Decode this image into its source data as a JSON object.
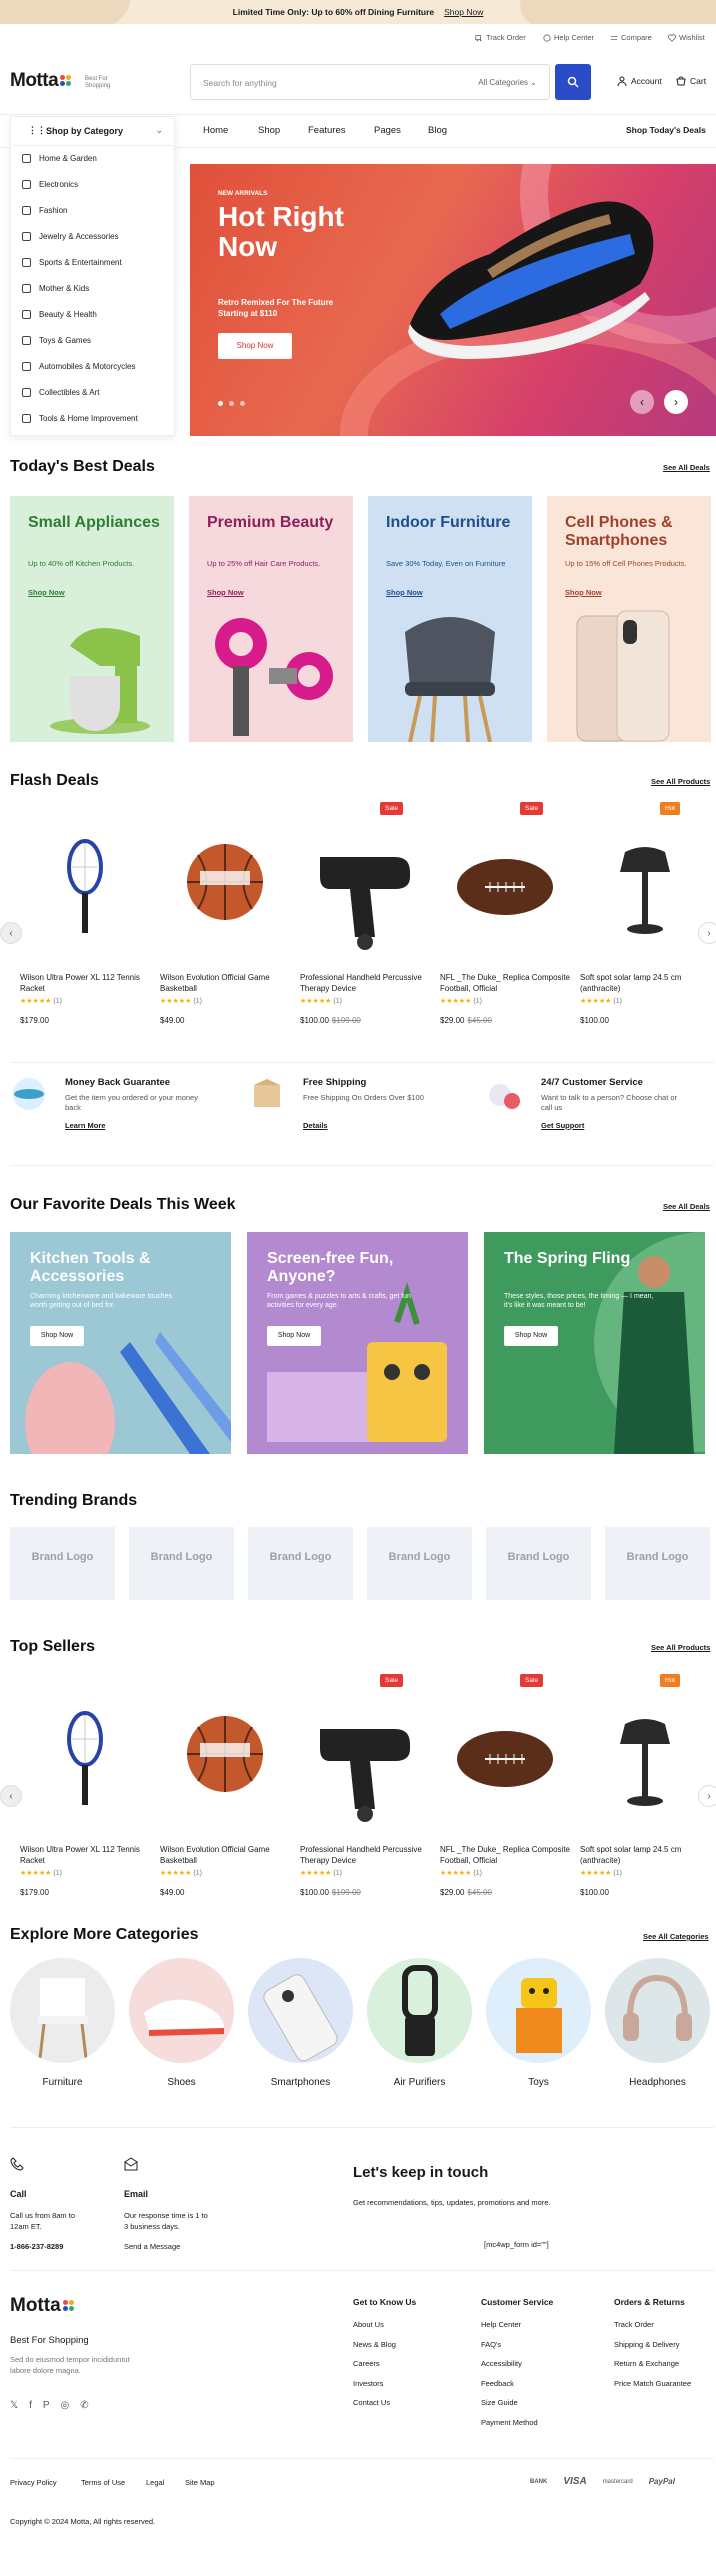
{
  "promo": {
    "text": "Limited Time Only: Up to 60% off Dining Furniture",
    "link": "Shop Now"
  },
  "toplinks": [
    "Track Order",
    "Help Center",
    "Compare",
    "Wishlist"
  ],
  "logo": {
    "name": "Motta",
    "sub1": "Best For",
    "sub2": "Shopping",
    "dot_colors": [
      "#e84c3d",
      "#f5a623",
      "#2a4cc9",
      "#27ae60"
    ]
  },
  "search": {
    "placeholder": "Search for anything",
    "category": "All Categories"
  },
  "header": {
    "account": "Account",
    "cart": "Cart"
  },
  "nav": {
    "category_button": "Shop by Category",
    "items": [
      "Home",
      "Shop",
      "Features",
      "Pages",
      "Blog"
    ],
    "right": "Shop Today's Deals"
  },
  "categories": [
    "Home & Garden",
    "Electronics",
    "Fashion",
    "Jewelry & Accessories",
    "Sports & Entertainment",
    "Mother & Kids",
    "Beauty & Health",
    "Toys & Games",
    "Automobiles & Motorcycles",
    "Collectibles & Art",
    "Tools & Home Improvement"
  ],
  "hero": {
    "tag": "NEW ARRIVALS",
    "title": "Hot Right Now",
    "subtitle": "Retro Remixed For The Future Starting at $110",
    "button": "Shop Now"
  },
  "best_deals": {
    "title": "Today's Best Deals",
    "link": "See All Deals",
    "cards": [
      {
        "title": "Small Appliances",
        "desc": "Up to 40% off Kitchen Products.",
        "link": "Shop Now",
        "bg": "#d8efd9",
        "color": "#2e7d32"
      },
      {
        "title": "Premium Beauty",
        "desc": "Up to 25% off Hair Care Products.",
        "link": "Shop Now",
        "bg": "#f6d9dd",
        "color": "#8e1f5b"
      },
      {
        "title": "Indoor Furniture",
        "desc": "Save 30% Today, Even on Furniture",
        "link": "Shop Now",
        "bg": "#cfe0f3",
        "color": "#1e4f8a"
      },
      {
        "title": "Cell Phones & Smartphones",
        "desc": "Up to 15% off Cell Phones Products.",
        "link": "Shop Now",
        "bg": "#f9e6d8",
        "color": "#a0412d"
      }
    ]
  },
  "flash": {
    "title": "Flash Deals",
    "link": "See All Products"
  },
  "products": [
    {
      "name": "Wilson Ultra Power XL 112 Tennis Racket",
      "stars": "★★★★★",
      "reviews": "(1)",
      "price": "$179.00",
      "old": "",
      "badge": ""
    },
    {
      "name": "Wilson Evolution Official Game Basketball",
      "stars": "★★★★★",
      "reviews": "(1)",
      "price": "$49.00",
      "old": "",
      "badge": ""
    },
    {
      "name": "Professional Handheld Percussive Therapy Device",
      "stars": "★★★★★",
      "reviews": "(1)",
      "price": "$100.00",
      "old": "$199.00",
      "badge": "Sale"
    },
    {
      "name": "NFL _The Duke_ Replica Composite Football, Official",
      "stars": "★★★★★",
      "reviews": "(1)",
      "price": "$29.00",
      "old": "$45.00",
      "badge": "Sale"
    },
    {
      "name": "Soft spot solar lamp 24.5 cm (anthracite)",
      "stars": "★★★★★",
      "reviews": "(1)",
      "price": "$100.00",
      "old": "",
      "badge": "Hot"
    }
  ],
  "features": [
    {
      "title": "Money Back Guarantee",
      "desc": "Get the item you ordered or your money back",
      "link": "Learn More"
    },
    {
      "title": "Free Shipping",
      "desc": "Free Shipping On Orders Over $100",
      "link": "Details"
    },
    {
      "title": "24/7 Customer Service",
      "desc": "Want to talk to a person? Choose chat or call us",
      "link": "Get Support"
    }
  ],
  "fav": {
    "title": "Our Favorite Deals This Week",
    "link": "See All Deals",
    "cards": [
      {
        "title": "Kitchen Tools & Accessories",
        "desc": "Charming kitchenware and bakeware touches worth getting out of bed for.",
        "button": "Shop Now",
        "bg": "#9cc7d4"
      },
      {
        "title": "Screen-free Fun, Anyone?",
        "desc": "From games & puzzles to arts & crafts, get fun activities for every age.",
        "button": "Shop Now",
        "bg": "#b38ad0"
      },
      {
        "title": "The Spring Fling",
        "desc": "These styles, those prices, the timing — I mean, it's like it was meant to be!",
        "button": "Shop Now",
        "bg": "#3f9a5e"
      }
    ]
  },
  "brands": {
    "title": "Trending Brands",
    "items": [
      "Brand Logo",
      "Brand Logo",
      "Brand Logo",
      "Brand Logo",
      "Brand Logo",
      "Brand Logo"
    ]
  },
  "top_sellers": {
    "title": "Top Sellers",
    "link": "See All Products"
  },
  "explore": {
    "title": "Explore More Categories",
    "link": "See All Categories",
    "items": [
      "Furniture",
      "Shoes",
      "Smartphones",
      "Air Purifiers",
      "Toys",
      "Headphones"
    ]
  },
  "contact": {
    "call_title": "Call",
    "call_text": "Call us from 8am to 12am ET.",
    "call_number": "1-866-237-8289",
    "email_title": "Email",
    "email_text": "Our response time is 1 to 3 business days.",
    "email_link": "Send a Message",
    "keep_title": "Let's keep in touch",
    "keep_text": "Get recommendations, tips, updates, promotions and more.",
    "form_code": "[mc4wp_form id=\"\"]"
  },
  "footer": {
    "tagline": "Best For Shopping",
    "desc": "Sed do eiusmod tempor incididuntut labore dolore magna.",
    "cols": [
      {
        "title": "Get to Know Us",
        "items": [
          "About Us",
          "News & Blog",
          "Careers",
          "Investors",
          "Contact Us"
        ]
      },
      {
        "title": "Customer Service",
        "items": [
          "Help Center",
          "FAQ's",
          "Accessibility",
          "Feedback",
          "Size Guide",
          "Payment Method"
        ]
      },
      {
        "title": "Orders & Returns",
        "items": [
          "Track Order",
          "Shipping & Delivery",
          "Return & Exchange",
          "Price Match Guarantee"
        ]
      }
    ],
    "bottom_links": [
      "Privacy Policy",
      "Terms of Use",
      "Legal",
      "Site Map"
    ],
    "payments": [
      "BANK",
      "VISA",
      "mastercard",
      "PayPal"
    ],
    "copyright": "Copyright © 2024 Motta, All rights reserved."
  }
}
